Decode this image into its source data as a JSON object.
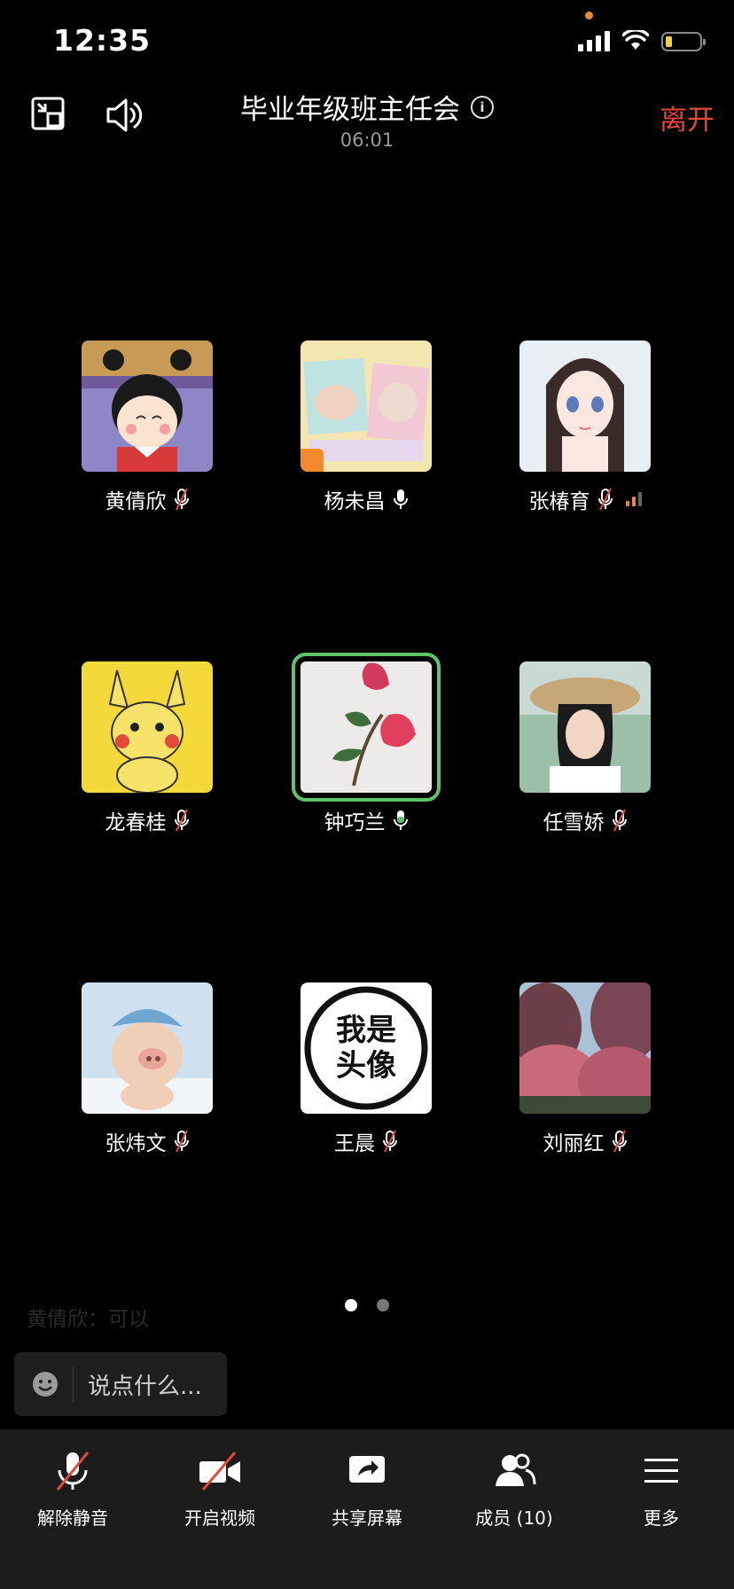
{
  "status_bar": {
    "time": "12:35"
  },
  "header": {
    "title": "毕业年级班主任会",
    "duration": "06:01",
    "leave_label": "离开"
  },
  "participants": [
    {
      "name": "黄倩欣",
      "muted": true
    },
    {
      "name": "杨未昌",
      "muted": false
    },
    {
      "name": "张椿育",
      "muted": true
    },
    {
      "name": "龙春桂",
      "muted": true
    },
    {
      "name": "钟巧兰",
      "muted": false,
      "speaking": true
    },
    {
      "name": "任雪娇",
      "muted": true
    },
    {
      "name": "张炜文",
      "muted": true
    },
    {
      "name": "王晨",
      "muted": true
    },
    {
      "name": "刘丽红",
      "muted": true
    }
  ],
  "avatar_texts": {
    "wang_chen": "我是头像"
  },
  "faded_message": "黄倩欣：可以",
  "pagination": {
    "current": 1,
    "total": 2
  },
  "chat": {
    "placeholder": "说点什么..."
  },
  "toolbar": {
    "unmute": "解除静音",
    "start_video": "开启视频",
    "share_screen": "共享屏幕",
    "members": "成员 (10)",
    "more": "更多"
  },
  "colors": {
    "leave": "#e2483c",
    "speaking_border": "#5ec46a",
    "mute_slash": "#e2483c",
    "toolbar_bg": "#1c1c1c"
  }
}
